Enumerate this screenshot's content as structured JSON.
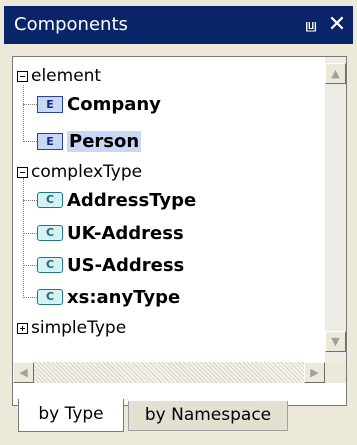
{
  "window": {
    "title": "Components",
    "pin_glyph": "⩏",
    "close_glyph": "✕"
  },
  "tree": {
    "groups": [
      {
        "label": "element",
        "expanded": true,
        "items": [
          {
            "kind": "element",
            "icon_letter": "E",
            "label": "Company",
            "selected": false
          },
          {
            "kind": "element",
            "icon_letter": "E",
            "label": "Person",
            "selected": true
          }
        ]
      },
      {
        "label": "complexType",
        "expanded": true,
        "items": [
          {
            "kind": "complexType",
            "icon_letter": "C",
            "label": "AddressType"
          },
          {
            "kind": "complexType",
            "icon_letter": "C",
            "label": "UK-Address"
          },
          {
            "kind": "complexType",
            "icon_letter": "C",
            "label": "US-Address"
          },
          {
            "kind": "complexType",
            "icon_letter": "C",
            "label": "xs:anyType"
          }
        ]
      },
      {
        "label": "simpleType",
        "expanded": false,
        "items": []
      }
    ]
  },
  "scrollbar": {
    "up_glyph": "▲",
    "down_glyph": "▼",
    "left_glyph": "◀",
    "right_glyph": "▶"
  },
  "tabs": [
    {
      "label": "by Type",
      "active": true
    },
    {
      "label": "by Namespace",
      "active": false
    }
  ],
  "colors": {
    "title_bar": "#0a246a",
    "element_icon": "#c9d7f5",
    "complex_type_icon": "#d4f2f4",
    "selection": "#c8d8f4"
  }
}
